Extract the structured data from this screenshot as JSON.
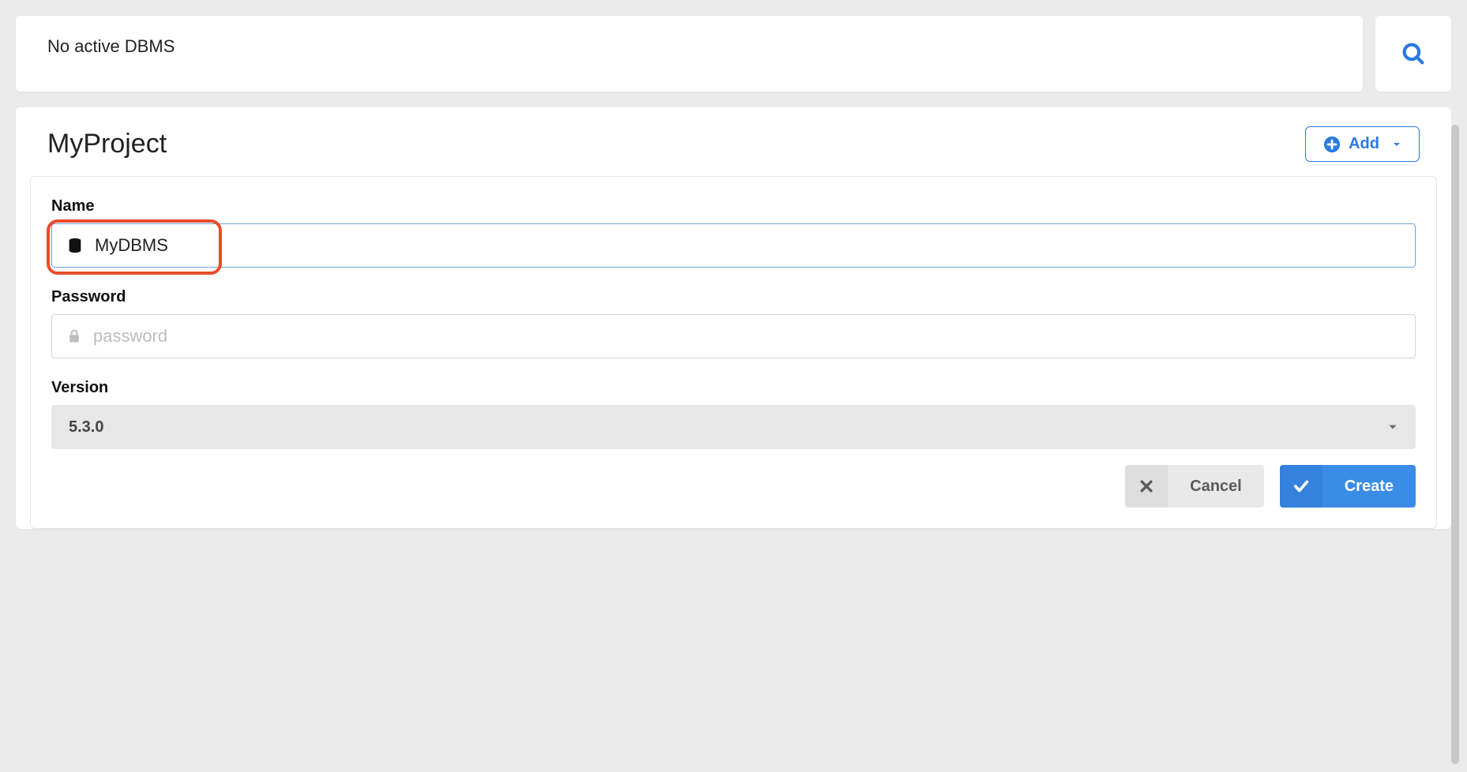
{
  "header": {
    "status_text": "No active DBMS"
  },
  "project": {
    "title": "MyProject",
    "add_button_label": "Add"
  },
  "form": {
    "name": {
      "label": "Name",
      "value": "MyDBMS"
    },
    "password": {
      "label": "Password",
      "value": "",
      "placeholder": "password"
    },
    "version": {
      "label": "Version",
      "selected": "5.3.0"
    }
  },
  "actions": {
    "cancel_label": "Cancel",
    "create_label": "Create"
  },
  "colors": {
    "accent_blue": "#3a8ce6",
    "link_blue": "#2a7bde",
    "highlight": "#e84c2b"
  }
}
